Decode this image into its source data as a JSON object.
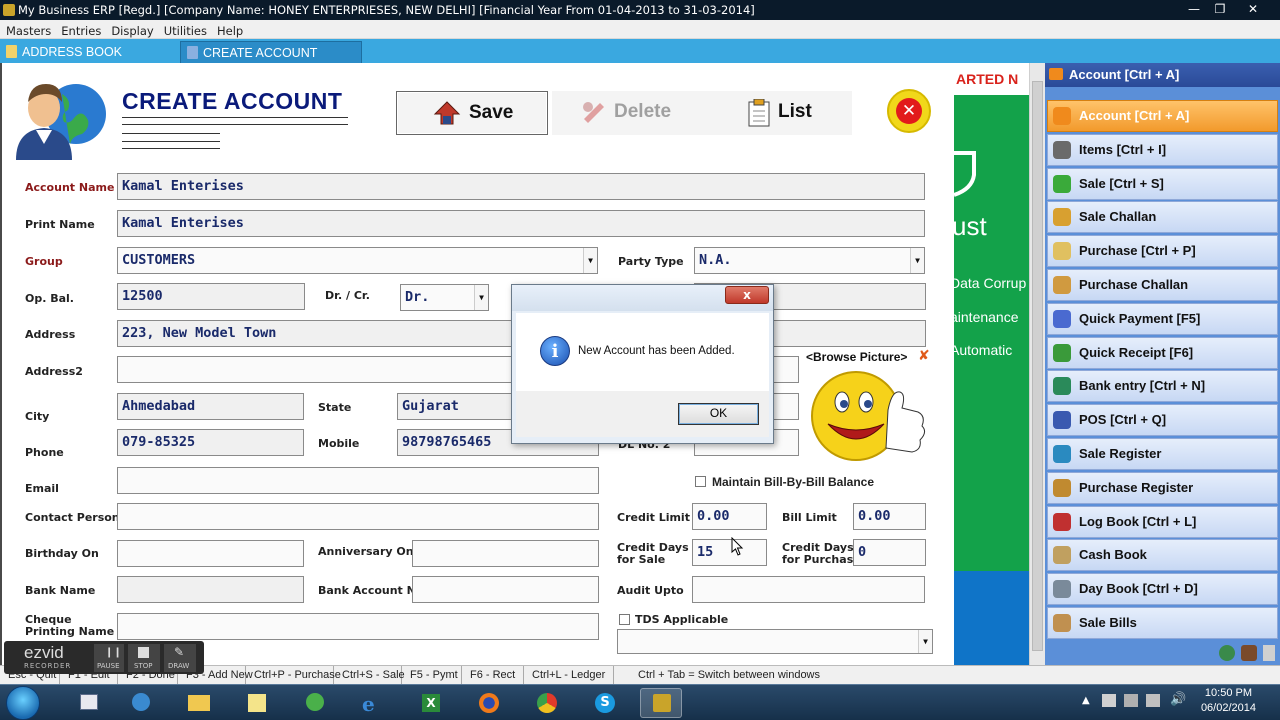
{
  "window": {
    "title": "My Business ERP [Regd.] [Company Name: HONEY ENTERPRIESES, NEW DELHI] [Financial Year From 01-04-2013 to 31-03-2014]"
  },
  "menu": [
    "Masters",
    "Entries",
    "Display",
    "Utilities",
    "Help"
  ],
  "tabs": [
    {
      "label": "ADDRESS BOOK",
      "active": false
    },
    {
      "label": "CREATE ACCOUNT",
      "active": true
    }
  ],
  "form": {
    "heading": "CREATE ACCOUNT",
    "toolbar": {
      "save": "Save",
      "delete": "Delete",
      "list": "List"
    },
    "labels": {
      "account_name": "Account Name",
      "print_name": "Print Name",
      "group": "Group",
      "party_type": "Party Type",
      "op_bal": "Op. Bal.",
      "dr_cr": "Dr. / Cr.",
      "address": "Address",
      "address2": "Address2",
      "city": "City",
      "state": "State",
      "phone": "Phone",
      "mobile": "Mobile",
      "email": "Email",
      "contact_person": "Contact Person",
      "birthday_on": "Birthday On",
      "anniversary_on": "Anniversary On",
      "bank_name": "Bank Name",
      "bank_account_no": "Bank Account No.",
      "cheque_printing_name_1": "Cheque",
      "cheque_printing_name_2": "Printing Name",
      "credit_limit": "Credit Limit",
      "bill_limit": "Bill Limit",
      "credit_days_sale_1": "Credit Days",
      "credit_days_sale_2": "for Sale",
      "credit_days_purchase_1": "Credit Days",
      "credit_days_purchase_2": "for Purchase",
      "audit_upto": "Audit Upto",
      "dl_no_2": "DL No. 2",
      "maintain_bill_by_bill": "Maintain Bill-By-Bill Balance",
      "tds_applicable": "TDS Applicable",
      "browse_picture": "<Browse Picture>"
    },
    "values": {
      "account_name": "Kamal Enterises",
      "print_name": "Kamal Enterises",
      "group": "CUSTOMERS",
      "party_type": "N.A.",
      "op_bal": "12500",
      "dr_cr": "Dr.",
      "address": "223, New Model Town",
      "address2": "",
      "city": "Ahmedabad",
      "state": "Gujarat",
      "phone": "079-85325",
      "mobile": "98798765465",
      "email": "",
      "contact_person": "",
      "birthday_on": "",
      "anniversary_on": "",
      "bank_name": "",
      "bank_account_no": "",
      "cheque_printing_name": "",
      "credit_limit": "0.00",
      "bill_limit": "0.00",
      "credit_days_sale": "15",
      "credit_days_purchase": "0",
      "audit_upto": ""
    }
  },
  "background_window": {
    "banner_text": "ARTED N",
    "lines": [
      "ust",
      "Data Corrup",
      "aintenance",
      "Automatic"
    ]
  },
  "sidebar": {
    "header": "Account [Ctrl + A]",
    "items": [
      {
        "label": "Account [Ctrl + A]",
        "active": true,
        "color": "#f08a1c"
      },
      {
        "label": "Items [Ctrl + I]",
        "color": "#6a6a6a"
      },
      {
        "label": "Sale [Ctrl + S]",
        "color": "#3aaa3a"
      },
      {
        "label": "Sale Challan",
        "color": "#d8a030"
      },
      {
        "label": "Purchase [Ctrl + P]",
        "color": "#e0c060"
      },
      {
        "label": "Purchase Challan",
        "color": "#d09a40"
      },
      {
        "label": "Quick Payment [F5]",
        "color": "#4a6ad0"
      },
      {
        "label": "Quick Receipt [F6]",
        "color": "#3a9a3a"
      },
      {
        "label": "Bank entry [Ctrl + N]",
        "color": "#2a8a5a"
      },
      {
        "label": "POS [Ctrl + Q]",
        "color": "#3a5ab0"
      },
      {
        "label": "Sale Register",
        "color": "#2a8ac0"
      },
      {
        "label": "Purchase Register",
        "color": "#c08a30"
      },
      {
        "label": "Log Book [Ctrl + L]",
        "color": "#c03030"
      },
      {
        "label": "Cash Book",
        "color": "#c0a060"
      },
      {
        "label": "Day Book [Ctrl + D]",
        "color": "#7a8a9a"
      },
      {
        "label": "Sale Bills",
        "color": "#c09050"
      }
    ]
  },
  "statusbar": [
    "Esc - Quit",
    "F1 - Edit",
    "F2 - Done",
    "F3 - Add New",
    "Ctrl+P - Purchase",
    "Ctrl+S - Sale",
    "F5 - Pymt",
    "F6 - Rect",
    "Ctrl+L - Ledger",
    "Ctrl + Tab = Switch between windows"
  ],
  "dialog": {
    "message": "New Account has been Added.",
    "ok": "OK",
    "close": "x"
  },
  "ezvid": {
    "brand": "ezvid",
    "sub": "RECORDER",
    "pause": "PAUSE",
    "stop": "STOP",
    "draw": "DRAW"
  },
  "taskbar": {
    "time": "10:50 PM",
    "date": "06/02/2014"
  },
  "colors": {
    "tab_bar": "#3aa8e0",
    "sidebar": "#5b8fd8",
    "sidebar_active": "#f08a1c",
    "heading": "#0a1a7a",
    "field_text": "#1a2a6a"
  }
}
